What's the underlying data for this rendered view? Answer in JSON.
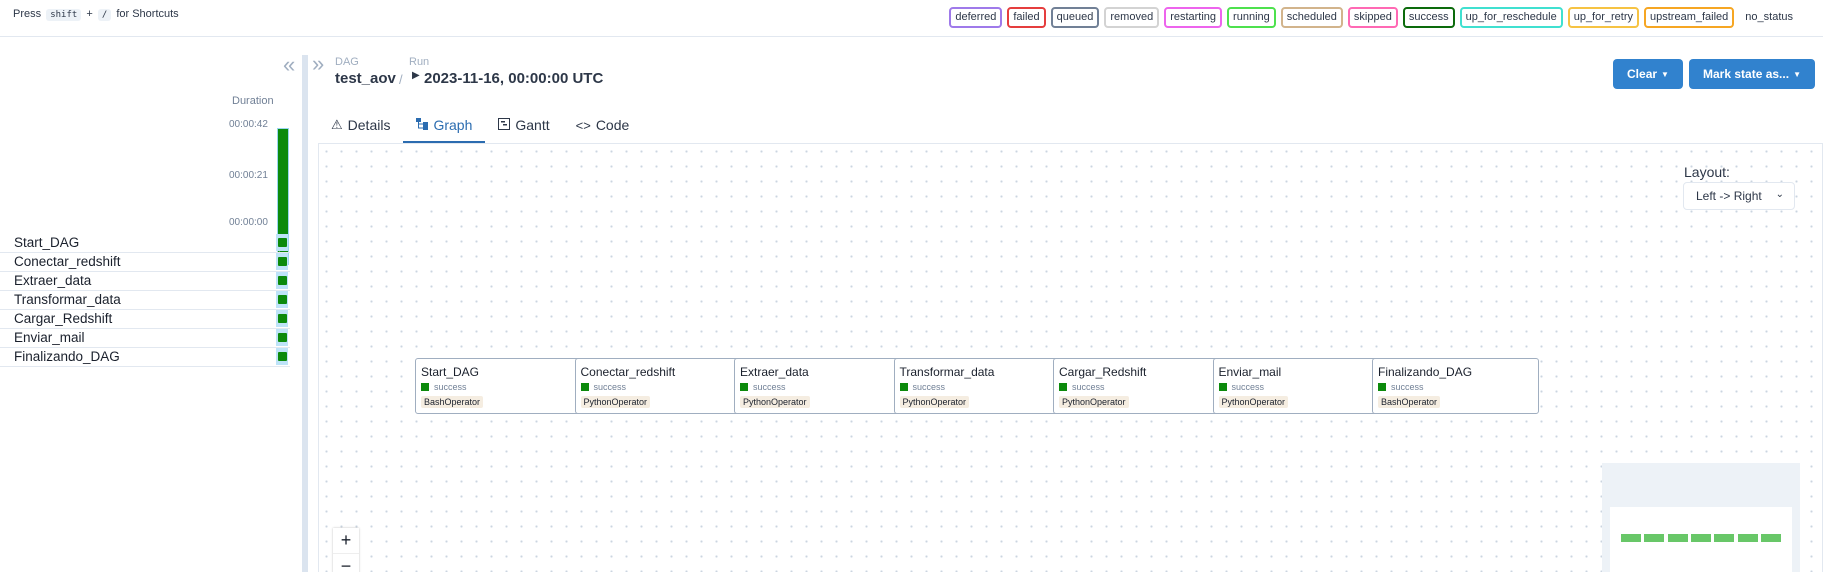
{
  "shortcut": {
    "press": "Press",
    "key1": "shift",
    "plus": "+",
    "key2": "/",
    "suffix": "for Shortcuts"
  },
  "legend": [
    {
      "label": "deferred",
      "color": "#9f7aea"
    },
    {
      "label": "failed",
      "color": "#e53e3e"
    },
    {
      "label": "queued",
      "color": "#718096"
    },
    {
      "label": "removed",
      "color": "#d3d3d3"
    },
    {
      "label": "restarting",
      "color": "#ed64ed"
    },
    {
      "label": "running",
      "color": "#4ee14e"
    },
    {
      "label": "scheduled",
      "color": "#d2b48c"
    },
    {
      "label": "skipped",
      "color": "#ff69b4"
    },
    {
      "label": "success",
      "color": "#0c6b0c"
    },
    {
      "label": "up_for_reschedule",
      "color": "#40e0d0"
    },
    {
      "label": "up_for_retry",
      "color": "#f6c343"
    },
    {
      "label": "upstream_failed",
      "color": "#f6a623"
    },
    {
      "label": "no_status",
      "color": "none"
    }
  ],
  "grid": {
    "duration_label": "Duration",
    "ticks": [
      "00:00:42",
      "00:00:21",
      "00:00:00"
    ],
    "run_state_color": "#0c8a0c",
    "tasks": [
      "Start_DAG",
      "Conectar_redshift",
      "Extraer_data",
      "Transformar_data",
      "Cargar_Redshift",
      "Enviar_mail",
      "Finalizando_DAG"
    ]
  },
  "breadcrumb": {
    "dag_label": "DAG",
    "dag_id": "test_aov",
    "sep": "/",
    "run_label": "Run",
    "run_id": "2023-11-16, 00:00:00 UTC"
  },
  "actions": {
    "clear": "Clear",
    "mark_state": "Mark state as..."
  },
  "tabs": [
    {
      "label": "Details",
      "icon": "warning-icon"
    },
    {
      "label": "Graph",
      "icon": "graph-icon"
    },
    {
      "label": "Gantt",
      "icon": "gantt-icon"
    },
    {
      "label": "Code",
      "icon": "code-icon"
    }
  ],
  "active_tab": "Graph",
  "graph": {
    "layout_label": "Layout:",
    "layout_value": "Left -> Right",
    "nodes": [
      {
        "name": "Start_DAG",
        "state": "success",
        "operator": "BashOperator"
      },
      {
        "name": "Conectar_redshift",
        "state": "success",
        "operator": "PythonOperator"
      },
      {
        "name": "Extraer_data",
        "state": "success",
        "operator": "PythonOperator"
      },
      {
        "name": "Transformar_data",
        "state": "success",
        "operator": "PythonOperator"
      },
      {
        "name": "Cargar_Redshift",
        "state": "success",
        "operator": "PythonOperator"
      },
      {
        "name": "Enviar_mail",
        "state": "success",
        "operator": "PythonOperator"
      },
      {
        "name": "Finalizando_DAG",
        "state": "success",
        "operator": "BashOperator"
      }
    ],
    "zoom_in": "+",
    "zoom_out": "−"
  }
}
